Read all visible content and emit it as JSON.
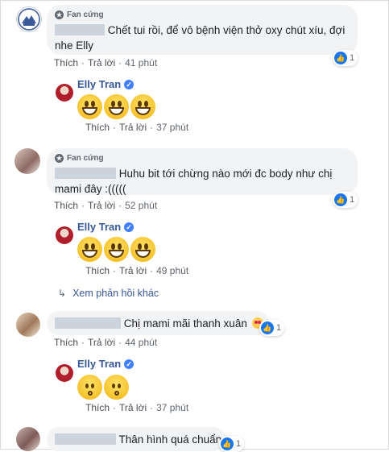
{
  "colors": {
    "link": "#365899",
    "like": "#1877f2",
    "bubble": "#f2f3f5"
  },
  "common": {
    "badge": "Fan cứng",
    "like": "Thích",
    "reply": "Trả lời",
    "sep": "·"
  },
  "comments": [
    {
      "text": "Chết tui rồi, để vô bệnh viện thở oxy chút xíu, đợi nhe Elly",
      "time": "41 phút",
      "likes": "1",
      "reply": {
        "name": "Elly Tran",
        "emoji": "grinning x3",
        "time": "37 phút"
      }
    },
    {
      "text": "Huhu bit tới chừng nào mới đc body như chị mami đây :(((((",
      "time": "52 phút",
      "likes": "1",
      "reply": {
        "name": "Elly Tran",
        "emoji": "grinning x3",
        "time": "49 phút"
      },
      "more_replies": "Xem phản hồi khác"
    },
    {
      "text": "Chị mami mãi thanh xuân",
      "emoji": "heart-eyes",
      "time": "44 phút",
      "likes": "1",
      "reply": {
        "name": "Elly Tran",
        "emoji": "kissing x2",
        "time": "37 phút"
      }
    },
    {
      "text": "Thân hình quá chuẩn",
      "likes": "1"
    }
  ]
}
